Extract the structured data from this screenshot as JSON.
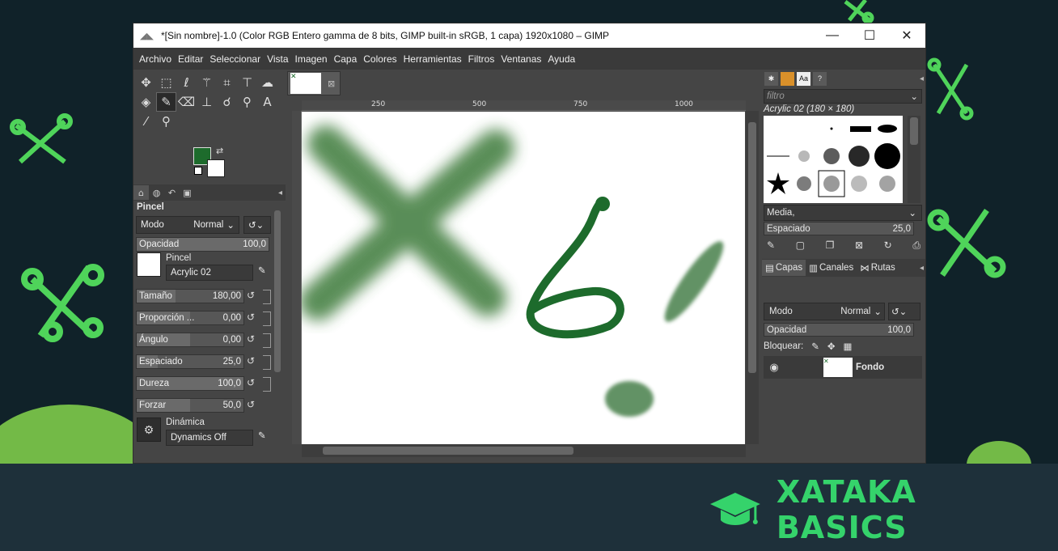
{
  "window": {
    "title": "*[Sin nombre]-1.0 (Color RGB Entero gamma de 8 bits, GIMP built-in sRGB, 1 capa) 1920x1080 – GIMP",
    "minimize": "—",
    "maximize": "☐",
    "close": "✕"
  },
  "menu": [
    "Archivo",
    "Editar",
    "Seleccionar",
    "Vista",
    "Imagen",
    "Capa",
    "Colores",
    "Herramientas",
    "Filtros",
    "Ventanas",
    "Ayuda"
  ],
  "colors": {
    "foreground": "#1d6b2c",
    "background": "#ffffff",
    "brand": "#35d36b"
  },
  "tool_options": {
    "header": "Pincel",
    "mode_label": "Modo",
    "mode_value": "Normal",
    "opacity_label": "Opacidad",
    "opacity_value": "100,0",
    "brush_label": "Pincel",
    "brush_value": "Acrylic 02",
    "size_label": "Tamaño",
    "size_value": "180,00",
    "aspect_label": "Proporción ...",
    "aspect_value": "0,00",
    "angle_label": "Ángulo",
    "angle_value": "0,00",
    "spacing_label": "Espaciado",
    "spacing_value": "25,0",
    "hardness_label": "Dureza",
    "hardness_value": "100,0",
    "force_label": "Forzar",
    "force_value": "50,0",
    "dynamics_label": "Dinámica",
    "dynamics_value": "Dynamics Off"
  },
  "ruler": {
    "ticks": [
      "250",
      "500",
      "750",
      "1000"
    ]
  },
  "brushes_panel": {
    "filter_placeholder": "filtro",
    "brush_info": "Acrylic 02 (180 × 180)",
    "tag": "Media,",
    "spacing_label": "Espaciado",
    "spacing_value": "25,0"
  },
  "layers_panel": {
    "tabs": [
      "Capas",
      "Canales",
      "Rutas"
    ],
    "mode_label": "Modo",
    "mode_value": "Normal",
    "opacity_label": "Opacidad",
    "opacity_value": "100,0",
    "lock_label": "Bloquear:",
    "layer_name": "Fondo"
  },
  "brand": {
    "text": "XATAKA BASICS"
  }
}
